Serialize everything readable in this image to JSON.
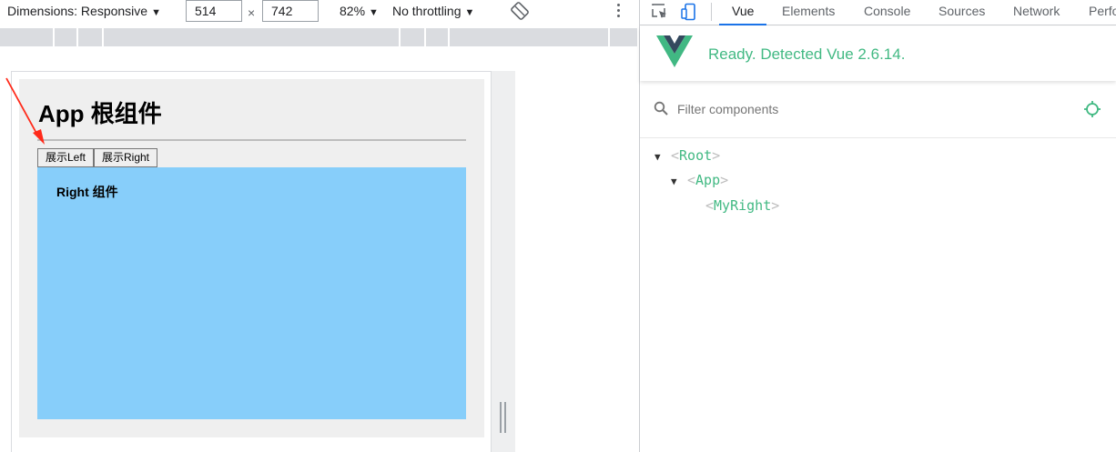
{
  "device_toolbar": {
    "dimensions_label": "Dimensions: Responsive",
    "width_value": "514",
    "times_symbol": "×",
    "height_value": "742",
    "zoom_label": "82%",
    "throttling_label": "No throttling",
    "dropdown_glyph": "▼"
  },
  "app_page": {
    "title": "App 根组件",
    "buttons": [
      "展示Left",
      "展示Right"
    ],
    "right_component_title": "Right 组件",
    "right_box_color": "#87cefa"
  },
  "devtools": {
    "tabs": [
      "Vue",
      "Elements",
      "Console",
      "Sources",
      "Network",
      "Perfo"
    ],
    "active_tab": "Vue",
    "vue_status": "Ready. Detected Vue 2.6.14.",
    "filter_placeholder": "Filter components",
    "accent_color": "#42b983",
    "component_tree": [
      {
        "name": "Root",
        "expanded": true,
        "depth": 0
      },
      {
        "name": "App",
        "expanded": true,
        "depth": 1
      },
      {
        "name": "MyRight",
        "expanded": false,
        "depth": 2
      }
    ],
    "tree_open_bracket": "<",
    "tree_close_bracket": ">",
    "caret_glyph": "▼"
  },
  "icons": {
    "inspect": "inspect-element-icon",
    "device": "device-toggle-icon",
    "rotate": "rotate-icon",
    "more": "kebab-menu-icon",
    "search": "search-icon",
    "target": "select-component-target-icon",
    "logo": "vue-logo-icon"
  }
}
